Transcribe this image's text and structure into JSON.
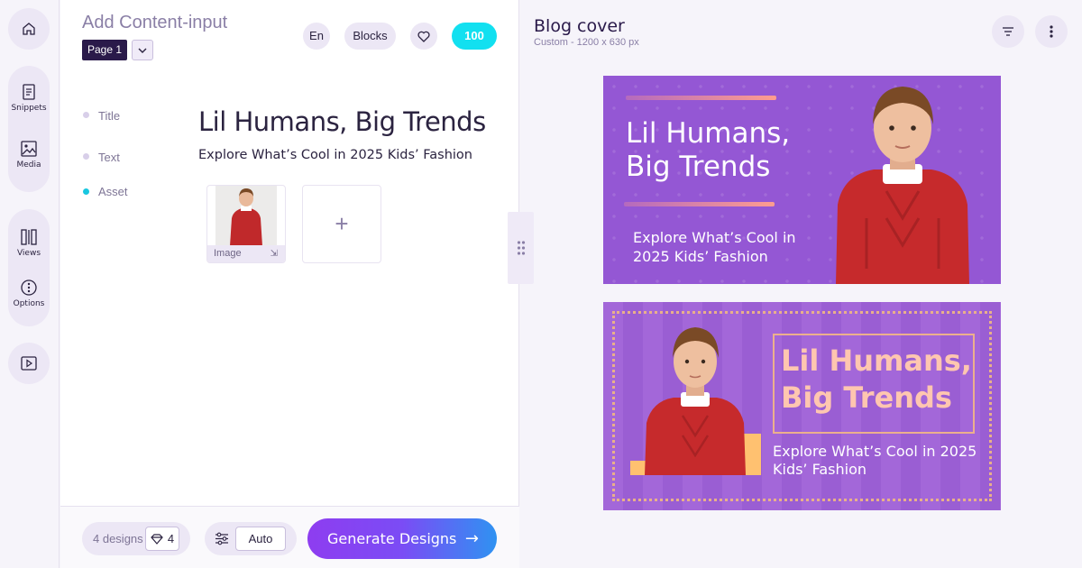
{
  "rail": {
    "items": [
      {
        "label": "Snippets",
        "icon": "document-icon"
      },
      {
        "label": "Media",
        "icon": "image-icon"
      },
      {
        "label": "Views",
        "icon": "columns-icon"
      },
      {
        "label": "Options",
        "icon": "options-icon"
      }
    ]
  },
  "panel": {
    "title": "Add Content-input",
    "page_label": "Page 1",
    "lang_label": "En",
    "blocks_label": "Blocks",
    "credits": "100",
    "fields": {
      "title_label": "Title",
      "text_label": "Text",
      "asset_label": "Asset",
      "title_value": "Lil Humans, Big Trends",
      "text_value": "Explore What’s Cool in 2025 Kids’ Fashion",
      "asset_caption": "Image",
      "add_symbol": "+"
    },
    "footer": {
      "designs_label": "4 designs",
      "designs_count": "4",
      "auto_label": "Auto",
      "generate_label": "Generate Designs"
    }
  },
  "preview": {
    "title": "Blog cover",
    "subtitle": "Custom - 1200 x 630 px",
    "design1": {
      "headline_line1": "Lil Humans,",
      "headline_line2": "Big Trends",
      "sub_line1": "Explore What’s Cool in",
      "sub_line2": "2025 Kids’ Fashion"
    },
    "design2": {
      "headline_line1": "Lil Humans,",
      "headline_line2": "Big Trends",
      "sub_line1": "Explore What’s Cool in 2025",
      "sub_line2": "Kids’ Fashion"
    }
  },
  "colors": {
    "accent_purple": "#8e3df0",
    "accent_cyan": "#12e0f0",
    "design_bg": "#9457d4",
    "headline_peach": "#ffc6b0"
  }
}
